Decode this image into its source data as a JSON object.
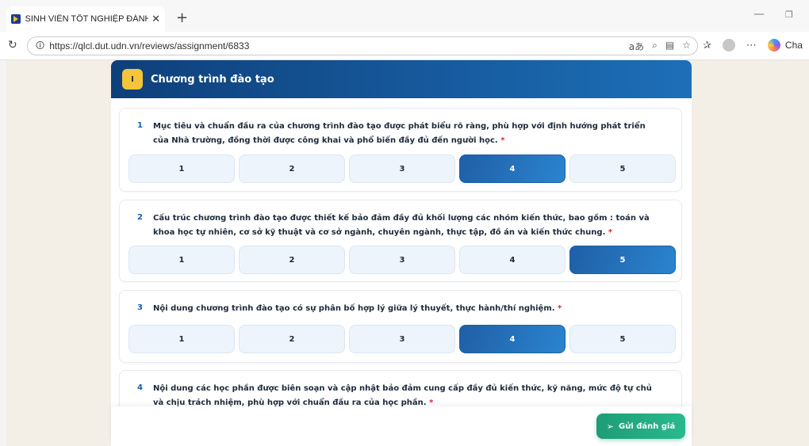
{
  "browser": {
    "tab_title": "SINH VIÊN TỐT NGHIỆP ĐÁNH GIÁ",
    "tab_close": "✕",
    "new_tab": "+",
    "url": "https://qlcl.dut.udn.vn/reviews/assignment/6833",
    "copilot_label": "Cha"
  },
  "section": {
    "badge": "I",
    "title": "Chương trình đào tạo"
  },
  "questions": [
    {
      "number": "1",
      "text": "Mục tiêu và chuẩn đầu ra của chương trình đào tạo được phát biểu rõ ràng, phù hợp với định hướng phát triển của Nhà trường, đồng thời được công khai và phổ biến đầy đủ đến người học.",
      "required": "*",
      "options": [
        "1",
        "2",
        "3",
        "4",
        "5"
      ],
      "selected": "4"
    },
    {
      "number": "2",
      "text": "Cấu trúc chương trình đào tạo được thiết kế bảo đảm đầy đủ khối lượng các nhóm kiến thức, bao gồm : toán và khoa học tự nhiên, cơ sở kỹ thuật và cơ sở ngành, chuyên ngành, thực tập, đồ án và kiến thức chung.",
      "required": "*",
      "options": [
        "1",
        "2",
        "3",
        "4",
        "5"
      ],
      "selected": "5"
    },
    {
      "number": "3",
      "text": "Nội dung chương trình đào tạo có sự phân bố hợp lý giữa lý thuyết, thực hành/thí nghiệm.",
      "required": "*",
      "options": [
        "1",
        "2",
        "3",
        "4",
        "5"
      ],
      "selected": "4"
    },
    {
      "number": "4",
      "text": "Nội dung các học phần được biên soạn và cập nhật bảo đảm cung cấp đầy đủ kiến thức, kỹ năng, mức độ tự chủ và chịu trách nhiệm, phù hợp với chuẩn đầu ra của học phần.",
      "required": "*"
    }
  ],
  "submit": {
    "label": "Gửi đánh giá",
    "icon": "send-icon"
  }
}
